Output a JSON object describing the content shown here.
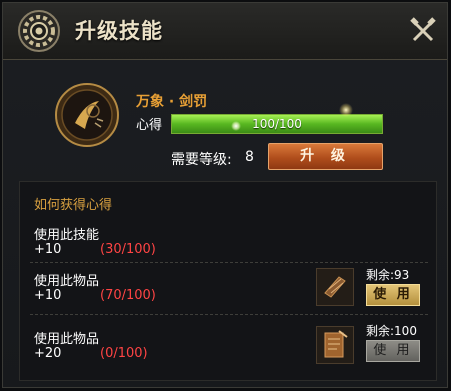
{
  "header": {
    "title": "升级技能"
  },
  "skill": {
    "name": "万象 · 剑罚",
    "xinde_label": "心得",
    "progress_text": "100/100",
    "progress_fraction": 1.0,
    "required_level_label": "需要等级:",
    "required_level_value": "8",
    "upgrade_label": "升 级"
  },
  "how_to": {
    "title": "如何获得心得",
    "rows": [
      {
        "label": "使用此技能",
        "bonus": "+10",
        "progress": "(30/100)"
      },
      {
        "label": "使用此物品",
        "bonus": "+10",
        "progress": "(70/100)",
        "remaining": "剩余:93",
        "use_label": "使 用"
      },
      {
        "label": "使用此物品",
        "bonus": "+20",
        "progress": "(0/100)",
        "remaining": "剩余:100",
        "use_label": "使 用"
      }
    ]
  },
  "colors": {
    "accent_orange": "#e8a035",
    "progress_green": "#58b721",
    "red_text": "#ff4444",
    "upgrade_button": "#b04e1c"
  },
  "icons": [
    "gear-emblem-icon",
    "crossed-tools-icon",
    "skill-emblem-icon",
    "item-scroll-icon",
    "item-scroll-bundle-icon"
  ]
}
